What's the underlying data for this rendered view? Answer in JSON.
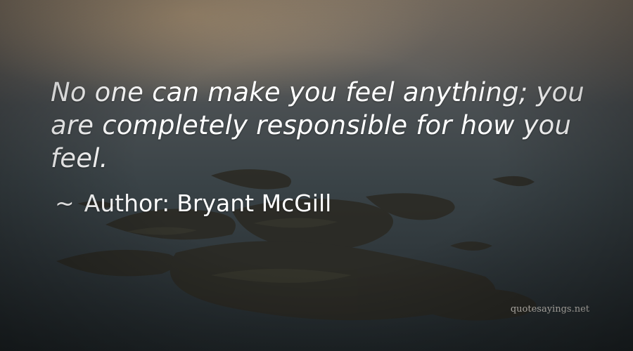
{
  "quote": {
    "text": "No one can make you feel anything; you are completely responsible for how you feel."
  },
  "author": {
    "dash": "~",
    "label": "Author:",
    "name": "Bryant McGill"
  },
  "watermark": "quotesayings.net",
  "colors": {
    "text": "#ffffff",
    "water": "#3a4347",
    "islands": "#2c2a24",
    "sky_glow": "#be a078"
  }
}
